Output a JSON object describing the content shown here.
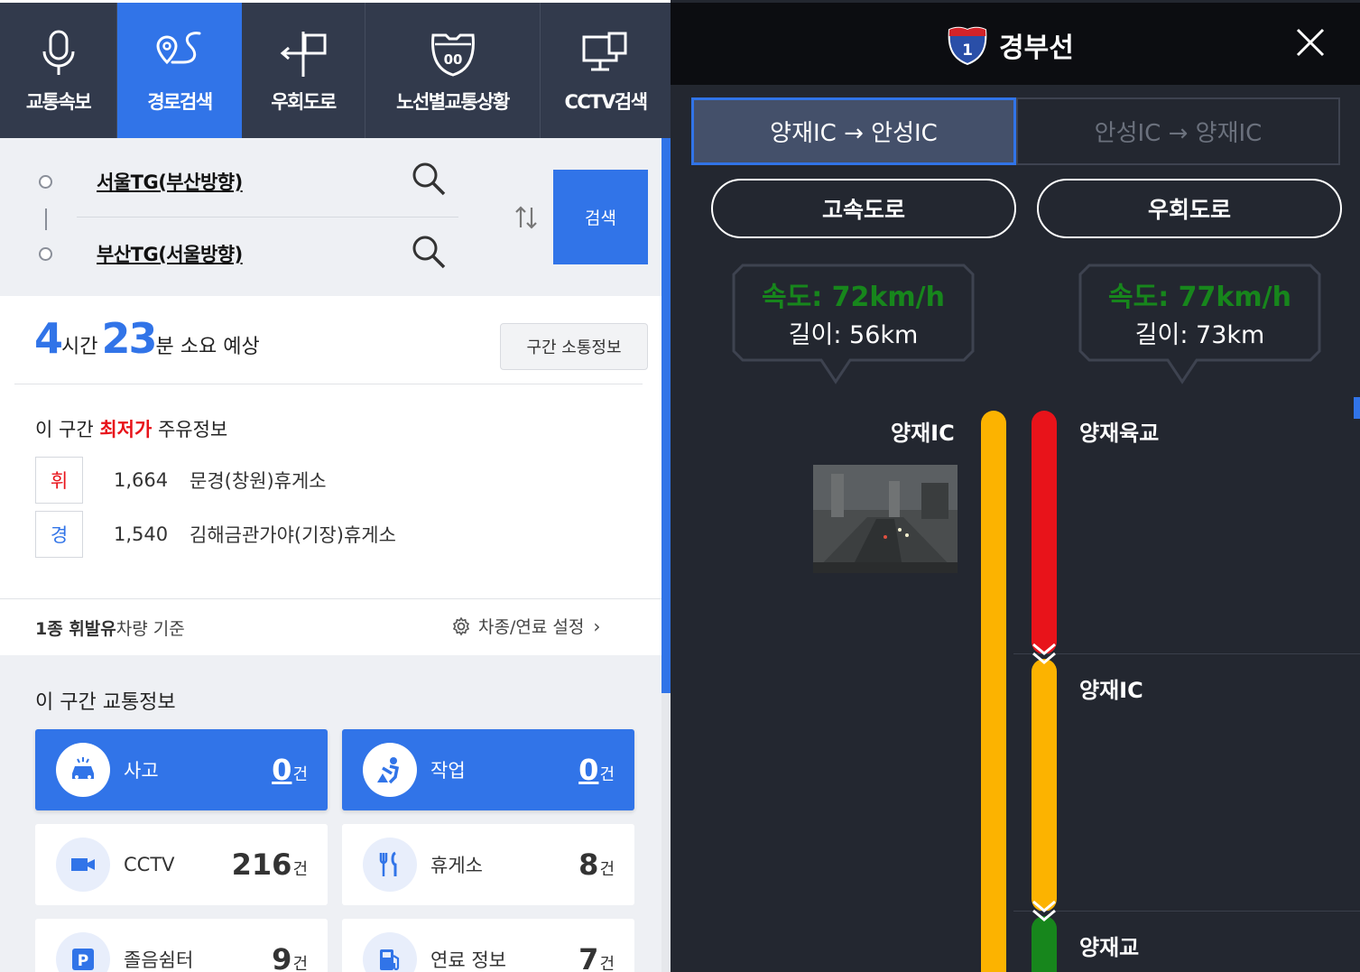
{
  "nav": {
    "items": [
      {
        "label": "교통속보",
        "icon": "microphone-icon"
      },
      {
        "label": "경로검색",
        "icon": "route-pin-icon",
        "active": true
      },
      {
        "label": "우회도로",
        "icon": "detour-sign-icon"
      },
      {
        "label": "노선별교통상황",
        "icon": "highway-shield-icon"
      },
      {
        "label": "CCTV검색",
        "icon": "monitor-camera-icon"
      }
    ]
  },
  "search": {
    "origin": "서울TG(부산방향)",
    "destination": "부산TG(서울방향)",
    "button_label": "검색"
  },
  "eta": {
    "hours": "4",
    "hours_unit": "시간",
    "minutes": "23",
    "minutes_unit": "분 소요 예상",
    "section_button": "구간 소통정보"
  },
  "fuel": {
    "title_prefix": "이 구간 ",
    "title_highlight": "최저가",
    "title_suffix": " 주유정보",
    "rows": [
      {
        "badge": "휘",
        "badge_color": "#e8131a",
        "price": "1,664",
        "name": "문경(창원)휴게소"
      },
      {
        "badge": "경",
        "badge_color": "#3174e8",
        "price": "1,540",
        "name": "김해금관가야(기장)휴게소"
      }
    ],
    "vehicle_bold": "1종 휘발유",
    "vehicle_rest": "차량 기준",
    "setting_label": "차종/연료 설정"
  },
  "traffic": {
    "title": "이 구간 교통정보",
    "cards": [
      {
        "label": "사고",
        "count": "0",
        "unit": "건",
        "icon": "accident-car-icon",
        "style": "blue"
      },
      {
        "label": "작업",
        "count": "0",
        "unit": "건",
        "icon": "road-work-icon",
        "style": "blue"
      },
      {
        "label": "CCTV",
        "count": "216",
        "unit": "건",
        "icon": "video-camera-icon",
        "style": "white"
      },
      {
        "label": "휴게소",
        "count": "8",
        "unit": "건",
        "icon": "fork-knife-icon",
        "style": "white"
      },
      {
        "label": "졸음쉼터",
        "count": "9",
        "unit": "건",
        "icon": "parking-icon",
        "style": "white"
      },
      {
        "label": "연료 정보",
        "count": "7",
        "unit": "건",
        "icon": "fuel-pump-icon",
        "style": "white"
      }
    ]
  },
  "right_panel": {
    "title": "경부선",
    "shield_number": "1",
    "tabs": [
      {
        "label": "양재IC → 안성IC",
        "active": true
      },
      {
        "label": "안성IC → 양재IC",
        "active": false
      }
    ],
    "road_types": [
      "고속도로",
      "우회도로"
    ],
    "stats": [
      {
        "speed": "속도: 72km/h",
        "length": "길이: 56km"
      },
      {
        "speed": "속도: 77km/h",
        "length": "길이: 73km"
      }
    ],
    "left_label": "양재IC",
    "segments": [
      {
        "name": "양재육교",
        "color": "#e8131a"
      },
      {
        "name": "양재IC",
        "color": "#fcb300"
      },
      {
        "name": "양재교",
        "color": "#17861c"
      }
    ],
    "colors": {
      "highway_bar": "#fcb300",
      "accent": "#3174e8"
    }
  }
}
